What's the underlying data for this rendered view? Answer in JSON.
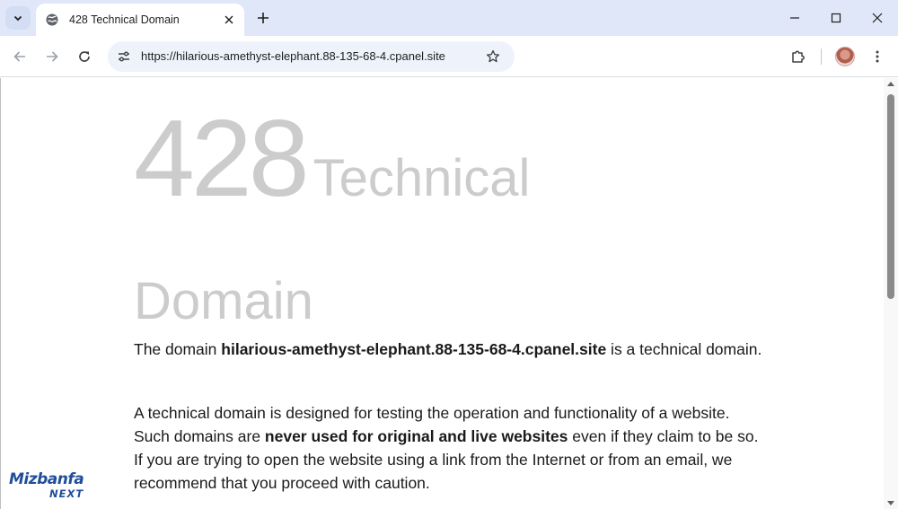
{
  "browser": {
    "tab": {
      "title": "428 Technical Domain",
      "favicon": "globe-icon"
    },
    "window_controls": [
      "minimize-icon",
      "maximize-icon",
      "close-icon"
    ],
    "address_bar": {
      "url": "https://hilarious-amethyst-elephant.88-135-68-4.cpanel.site"
    },
    "accent_color": "#dfe7f8"
  },
  "page": {
    "heading": {
      "code": "428",
      "word1": "Technical",
      "word2": "Domain"
    },
    "paragraph1": {
      "prefix": "The domain ",
      "domain": "hilarious-amethyst-elephant.88-135-68-4.cpanel.site",
      "suffix": " is a technical domain."
    },
    "paragraph2": {
      "text1": "A technical domain is designed for testing the operation and functionality of a website. Such domains are ",
      "bold": "never used for original and live websites",
      "text2": " even if they claim to be so. If you are trying to open the website using a link from the Internet or from an email, we recommend that you proceed with caution."
    }
  },
  "watermark": {
    "line1": "Mizbanfa",
    "line2": "NEXT"
  }
}
